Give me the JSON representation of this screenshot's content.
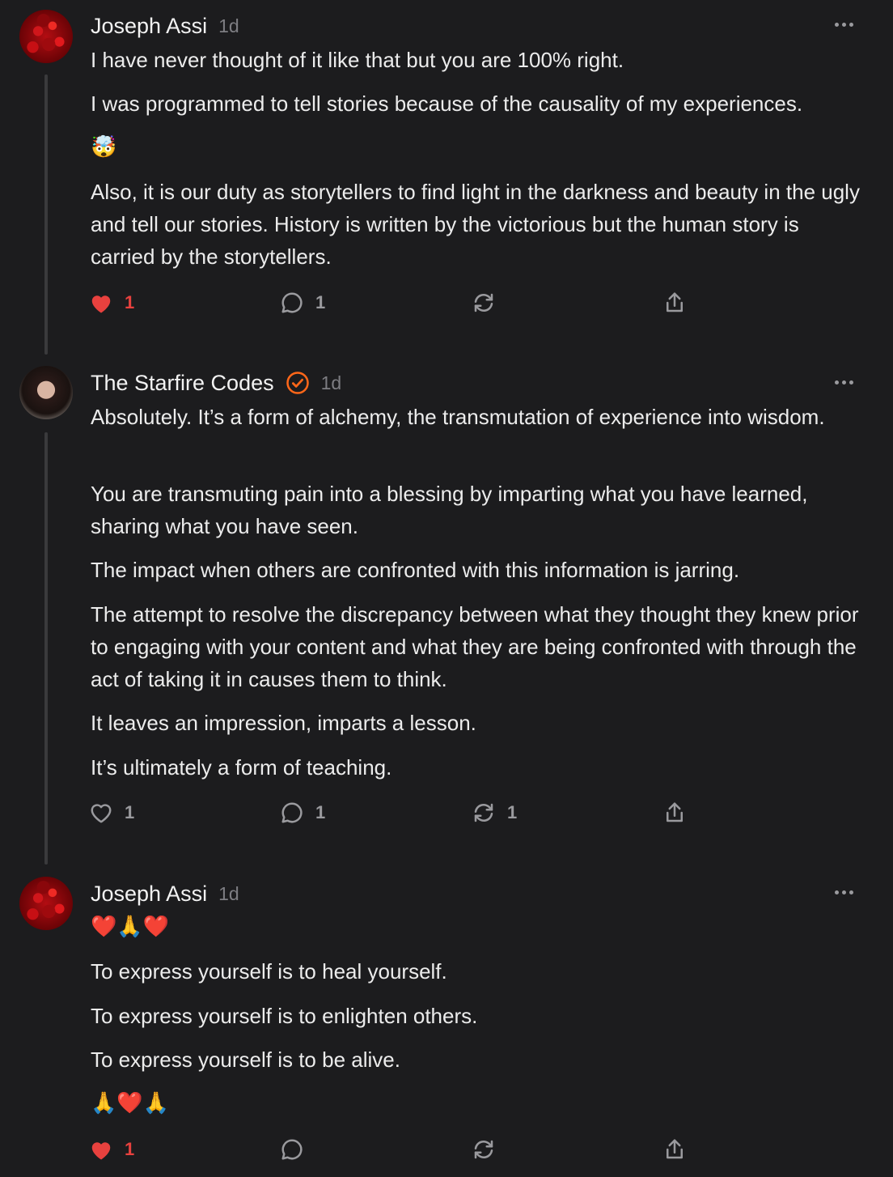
{
  "comments": [
    {
      "author": "Joseph Assi",
      "time": "1d",
      "verified": false,
      "paragraphs": [
        "I have never thought of it like that but you are 100% right.",
        "I was programmed to tell stories because of the causality of my experiences.",
        "🤯",
        "Also, it is our duty as storytellers to find light in the darkness and beauty in the ugly and tell our stories. History is written by the victorious but the human story is carried by the storytellers."
      ],
      "likes": "1",
      "liked": true,
      "replies": "1",
      "restacks": "",
      "like_color": "#e8413e"
    },
    {
      "author": "The Starfire Codes",
      "time": "1d",
      "verified": true,
      "verified_color": "#ff6719",
      "paragraphs": [
        "Absolutely. It’s a form of alchemy, the transmutation of experience into wisdom.",
        "You are transmuting pain into a blessing by imparting what you have learned, sharing what you have seen.",
        "The impact when others are confronted with this information is jarring.",
        "The attempt to resolve the discrepancy between what they thought they knew prior to engaging with your content and what they are being confronted with through the act of taking it in causes them to think.",
        "It leaves an impression, imparts a lesson.",
        "It’s ultimately a form of teaching."
      ],
      "likes": "1",
      "liked": false,
      "replies": "1",
      "restacks": "1"
    },
    {
      "author": "Joseph Assi",
      "time": "1d",
      "verified": false,
      "paragraphs": [
        "❤️🙏❤️",
        "To express yourself is to heal yourself.",
        "To express yourself is to enlighten others.",
        "To express yourself is to be alive.",
        "🙏❤️🙏"
      ],
      "likes": "1",
      "liked": true,
      "replies": "",
      "restacks": ""
    }
  ],
  "icons": {
    "like": "heart-icon",
    "reply": "comment-bubble-icon",
    "restack": "restack-icon",
    "share": "share-icon",
    "more": "more-options-icon",
    "verified": "verified-check-icon"
  }
}
